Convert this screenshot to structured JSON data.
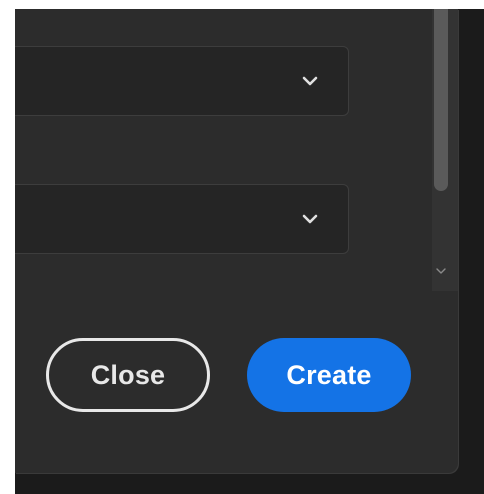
{
  "dialog": {
    "fields": [
      {
        "value": "",
        "icon": "chevron-down-icon"
      },
      {
        "value": "",
        "icon": "chevron-down-icon"
      }
    ],
    "buttons": {
      "close_label": "Close",
      "create_label": "Create"
    },
    "colors": {
      "background": "#2c2c2c",
      "field_background": "#252525",
      "primary": "#1473e6",
      "outline": "#e8e8e8"
    }
  }
}
